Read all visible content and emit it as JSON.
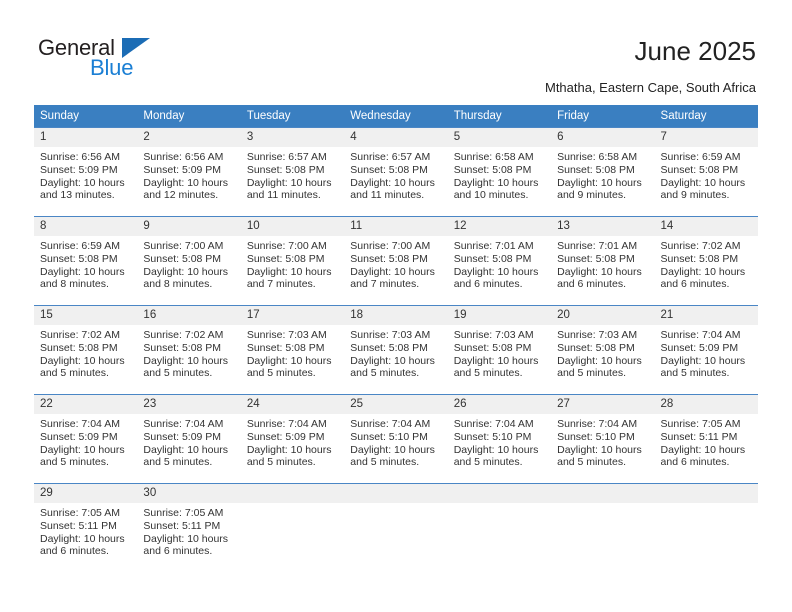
{
  "logo": {
    "word_one": "General",
    "word_two": "Blue",
    "triangle_color": "#1b6cb5",
    "blue_color": "#1b7fd4"
  },
  "header": {
    "title": "June 2025",
    "subtitle": "Mthatha, Eastern Cape, South Africa",
    "header_bg_color": "#3a7fc1",
    "daynum_bg_color": "#f0f0f0"
  },
  "weekdays": [
    "Sunday",
    "Monday",
    "Tuesday",
    "Wednesday",
    "Thursday",
    "Friday",
    "Saturday"
  ],
  "weeks": [
    [
      {
        "day": "1",
        "sunrise": "Sunrise: 6:56 AM",
        "sunset": "Sunset: 5:09 PM",
        "daylight": "Daylight: 10 hours and 13 minutes."
      },
      {
        "day": "2",
        "sunrise": "Sunrise: 6:56 AM",
        "sunset": "Sunset: 5:09 PM",
        "daylight": "Daylight: 10 hours and 12 minutes."
      },
      {
        "day": "3",
        "sunrise": "Sunrise: 6:57 AM",
        "sunset": "Sunset: 5:08 PM",
        "daylight": "Daylight: 10 hours and 11 minutes."
      },
      {
        "day": "4",
        "sunrise": "Sunrise: 6:57 AM",
        "sunset": "Sunset: 5:08 PM",
        "daylight": "Daylight: 10 hours and 11 minutes."
      },
      {
        "day": "5",
        "sunrise": "Sunrise: 6:58 AM",
        "sunset": "Sunset: 5:08 PM",
        "daylight": "Daylight: 10 hours and 10 minutes."
      },
      {
        "day": "6",
        "sunrise": "Sunrise: 6:58 AM",
        "sunset": "Sunset: 5:08 PM",
        "daylight": "Daylight: 10 hours and 9 minutes."
      },
      {
        "day": "7",
        "sunrise": "Sunrise: 6:59 AM",
        "sunset": "Sunset: 5:08 PM",
        "daylight": "Daylight: 10 hours and 9 minutes."
      }
    ],
    [
      {
        "day": "8",
        "sunrise": "Sunrise: 6:59 AM",
        "sunset": "Sunset: 5:08 PM",
        "daylight": "Daylight: 10 hours and 8 minutes."
      },
      {
        "day": "9",
        "sunrise": "Sunrise: 7:00 AM",
        "sunset": "Sunset: 5:08 PM",
        "daylight": "Daylight: 10 hours and 8 minutes."
      },
      {
        "day": "10",
        "sunrise": "Sunrise: 7:00 AM",
        "sunset": "Sunset: 5:08 PM",
        "daylight": "Daylight: 10 hours and 7 minutes."
      },
      {
        "day": "11",
        "sunrise": "Sunrise: 7:00 AM",
        "sunset": "Sunset: 5:08 PM",
        "daylight": "Daylight: 10 hours and 7 minutes."
      },
      {
        "day": "12",
        "sunrise": "Sunrise: 7:01 AM",
        "sunset": "Sunset: 5:08 PM",
        "daylight": "Daylight: 10 hours and 6 minutes."
      },
      {
        "day": "13",
        "sunrise": "Sunrise: 7:01 AM",
        "sunset": "Sunset: 5:08 PM",
        "daylight": "Daylight: 10 hours and 6 minutes."
      },
      {
        "day": "14",
        "sunrise": "Sunrise: 7:02 AM",
        "sunset": "Sunset: 5:08 PM",
        "daylight": "Daylight: 10 hours and 6 minutes."
      }
    ],
    [
      {
        "day": "15",
        "sunrise": "Sunrise: 7:02 AM",
        "sunset": "Sunset: 5:08 PM",
        "daylight": "Daylight: 10 hours and 5 minutes."
      },
      {
        "day": "16",
        "sunrise": "Sunrise: 7:02 AM",
        "sunset": "Sunset: 5:08 PM",
        "daylight": "Daylight: 10 hours and 5 minutes."
      },
      {
        "day": "17",
        "sunrise": "Sunrise: 7:03 AM",
        "sunset": "Sunset: 5:08 PM",
        "daylight": "Daylight: 10 hours and 5 minutes."
      },
      {
        "day": "18",
        "sunrise": "Sunrise: 7:03 AM",
        "sunset": "Sunset: 5:08 PM",
        "daylight": "Daylight: 10 hours and 5 minutes."
      },
      {
        "day": "19",
        "sunrise": "Sunrise: 7:03 AM",
        "sunset": "Sunset: 5:08 PM",
        "daylight": "Daylight: 10 hours and 5 minutes."
      },
      {
        "day": "20",
        "sunrise": "Sunrise: 7:03 AM",
        "sunset": "Sunset: 5:08 PM",
        "daylight": "Daylight: 10 hours and 5 minutes."
      },
      {
        "day": "21",
        "sunrise": "Sunrise: 7:04 AM",
        "sunset": "Sunset: 5:09 PM",
        "daylight": "Daylight: 10 hours and 5 minutes."
      }
    ],
    [
      {
        "day": "22",
        "sunrise": "Sunrise: 7:04 AM",
        "sunset": "Sunset: 5:09 PM",
        "daylight": "Daylight: 10 hours and 5 minutes."
      },
      {
        "day": "23",
        "sunrise": "Sunrise: 7:04 AM",
        "sunset": "Sunset: 5:09 PM",
        "daylight": "Daylight: 10 hours and 5 minutes."
      },
      {
        "day": "24",
        "sunrise": "Sunrise: 7:04 AM",
        "sunset": "Sunset: 5:09 PM",
        "daylight": "Daylight: 10 hours and 5 minutes."
      },
      {
        "day": "25",
        "sunrise": "Sunrise: 7:04 AM",
        "sunset": "Sunset: 5:10 PM",
        "daylight": "Daylight: 10 hours and 5 minutes."
      },
      {
        "day": "26",
        "sunrise": "Sunrise: 7:04 AM",
        "sunset": "Sunset: 5:10 PM",
        "daylight": "Daylight: 10 hours and 5 minutes."
      },
      {
        "day": "27",
        "sunrise": "Sunrise: 7:04 AM",
        "sunset": "Sunset: 5:10 PM",
        "daylight": "Daylight: 10 hours and 5 minutes."
      },
      {
        "day": "28",
        "sunrise": "Sunrise: 7:05 AM",
        "sunset": "Sunset: 5:11 PM",
        "daylight": "Daylight: 10 hours and 6 minutes."
      }
    ],
    [
      {
        "day": "29",
        "sunrise": "Sunrise: 7:05 AM",
        "sunset": "Sunset: 5:11 PM",
        "daylight": "Daylight: 10 hours and 6 minutes."
      },
      {
        "day": "30",
        "sunrise": "Sunrise: 7:05 AM",
        "sunset": "Sunset: 5:11 PM",
        "daylight": "Daylight: 10 hours and 6 minutes."
      },
      {
        "day": "",
        "sunrise": "",
        "sunset": "",
        "daylight": ""
      },
      {
        "day": "",
        "sunrise": "",
        "sunset": "",
        "daylight": ""
      },
      {
        "day": "",
        "sunrise": "",
        "sunset": "",
        "daylight": ""
      },
      {
        "day": "",
        "sunrise": "",
        "sunset": "",
        "daylight": ""
      },
      {
        "day": "",
        "sunrise": "",
        "sunset": "",
        "daylight": ""
      }
    ]
  ]
}
